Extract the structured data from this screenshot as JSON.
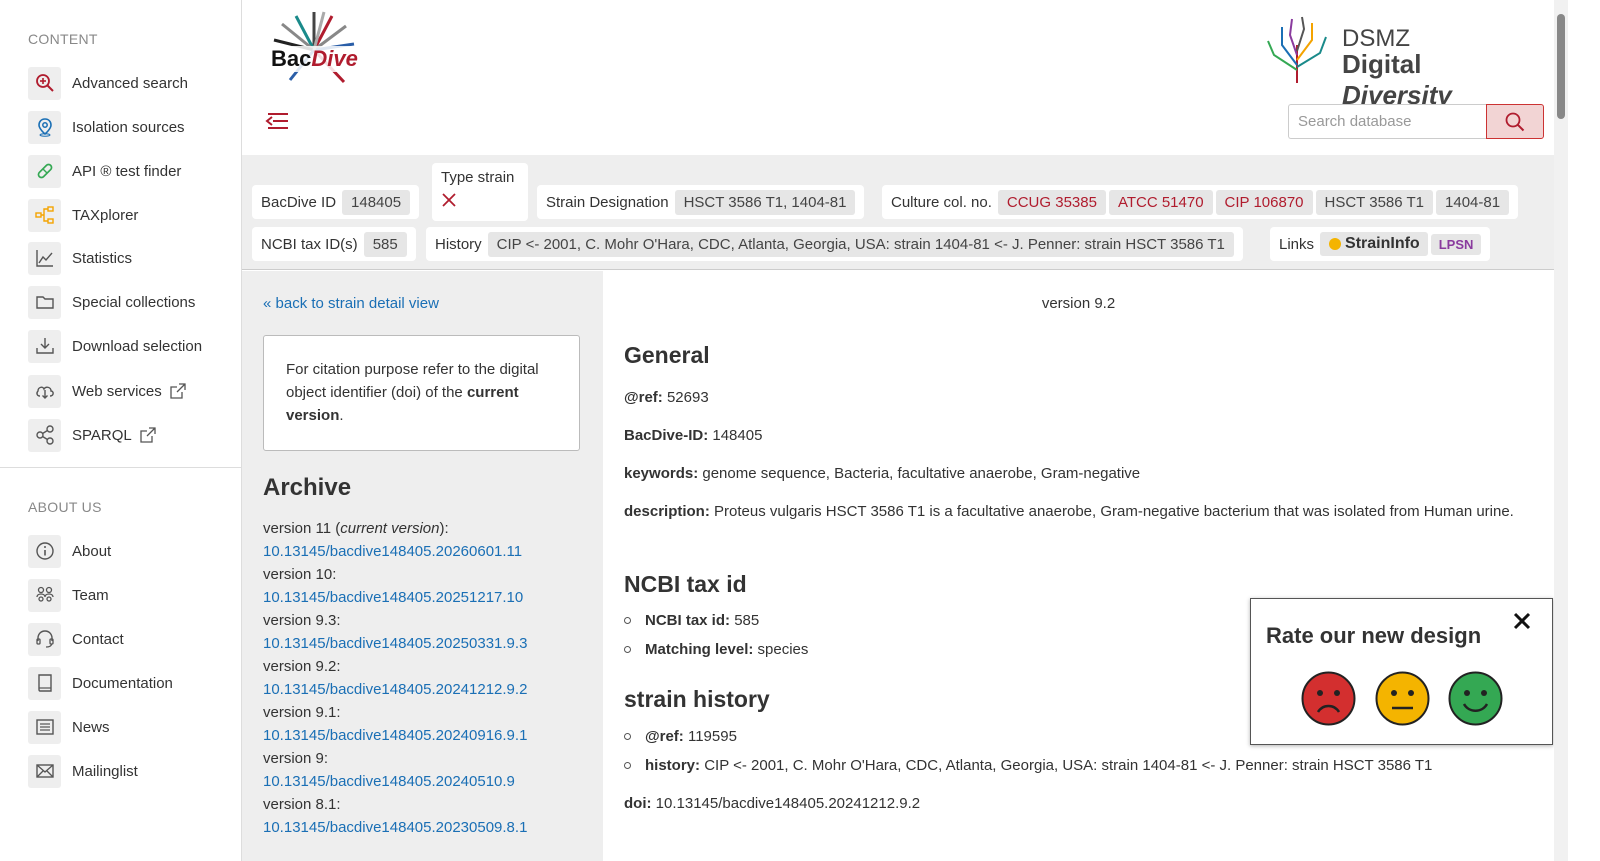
{
  "sidebar": {
    "content_heading": "CONTENT",
    "content_items": [
      {
        "label": "Advanced search",
        "icon": "search-plus-icon"
      },
      {
        "label": "Isolation sources",
        "icon": "location-pin-icon"
      },
      {
        "label": "API ® test finder",
        "icon": "pill-icon"
      },
      {
        "label": "TAXplorer",
        "icon": "tree-icon"
      },
      {
        "label": "Statistics",
        "icon": "line-chart-icon"
      },
      {
        "label": "Special collections",
        "icon": "folder-icon"
      },
      {
        "label": "Download selection",
        "icon": "download-icon"
      },
      {
        "label": "Web services",
        "icon": "cloud-download-icon"
      },
      {
        "label": "SPARQL",
        "icon": "share-nodes-icon"
      }
    ],
    "about_heading": "ABOUT US",
    "about_items": [
      {
        "label": "About",
        "icon": "info-icon"
      },
      {
        "label": "Team",
        "icon": "team-icon"
      },
      {
        "label": "Contact",
        "icon": "headset-icon"
      },
      {
        "label": "Documentation",
        "icon": "book-icon"
      },
      {
        "label": "News",
        "icon": "newspaper-icon"
      },
      {
        "label": "Mailinglist",
        "icon": "envelope-icon"
      }
    ]
  },
  "header": {
    "logo_text": "BacDive",
    "dsmz_line1": "DSMZ",
    "dsmz_line2a": "Digital",
    "dsmz_line2b": "Diversity",
    "search_placeholder": "Search database"
  },
  "infobar": {
    "bacdive_id_label": "BacDive ID",
    "bacdive_id": "148405",
    "type_strain_label": "Type strain",
    "strain_designation_label": "Strain Designation",
    "strain_designation": "HSCT 3586 T1, 1404-81",
    "culture_label": "Culture col. no.",
    "culture_nos": [
      "CCUG 35385",
      "ATCC 51470",
      "CIP 106870",
      "HSCT 3586 T1",
      "1404-81"
    ],
    "ncbi_label": "NCBI tax ID(s)",
    "ncbi_id": "585",
    "history_label": "History",
    "history": "CIP <- 2001, C. Mohr O'Hara, CDC, Atlanta, Georgia, USA: strain 1404-81 <- J. Penner: strain HSCT 3586 T1",
    "links_label": "Links",
    "link_straininfo": "StrainInfo",
    "link_lpsn": "LPSN"
  },
  "left": {
    "back_link": "« back to strain detail view",
    "citation_pre": "For citation purpose refer to the digital object identifier (doi) of the ",
    "citation_bold": "current version",
    "citation_post": ".",
    "archive_title": "Archive",
    "archive": [
      {
        "version": "version 11 (",
        "current": "current version",
        "suffix": "):",
        "doi": "10.13145/bacdive148405.20260601.11"
      },
      {
        "version": "version 10:",
        "current": "",
        "suffix": "",
        "doi": "10.13145/bacdive148405.20251217.10"
      },
      {
        "version": "version 9.3:",
        "current": "",
        "suffix": "",
        "doi": "10.13145/bacdive148405.20250331.9.3"
      },
      {
        "version": "version 9.2:",
        "current": "",
        "suffix": "",
        "doi": "10.13145/bacdive148405.20241212.9.2"
      },
      {
        "version": "version 9.1:",
        "current": "",
        "suffix": "",
        "doi": "10.13145/bacdive148405.20240916.9.1"
      },
      {
        "version": "version 9:",
        "current": "",
        "suffix": "",
        "doi": "10.13145/bacdive148405.20240510.9"
      },
      {
        "version": "version 8.1:",
        "current": "",
        "suffix": "",
        "doi": "10.13145/bacdive148405.20230509.8.1"
      }
    ]
  },
  "main": {
    "version": "version 9.2",
    "general_title": "General",
    "ref_label": "@ref:",
    "ref_value": "52693",
    "bacdive_id_label": "BacDive-ID:",
    "bacdive_id_value": "148405",
    "keywords_label": "keywords:",
    "keywords_value": "genome sequence, Bacteria, facultative anaerobe, Gram-negative",
    "description_label": "description:",
    "description_value": "Proteus vulgaris HSCT 3586 T1 is a facultative anaerobe, Gram-negative bacterium that was isolated from Human urine.",
    "ncbi_title": "NCBI tax id",
    "ncbi_taxid_label": "NCBI tax id:",
    "ncbi_taxid_value": "585",
    "matching_label": "Matching level:",
    "matching_value": "species",
    "history_title": "strain history",
    "hist_ref_label": "@ref:",
    "hist_ref_value": "119595",
    "hist_label": "history:",
    "hist_value": "CIP <- 2001, C. Mohr O'Hara, CDC, Atlanta, Georgia, USA: strain 1404-81 <- J. Penner: strain HSCT 3586 T1",
    "doi_label": "doi:",
    "doi_value": "10.13145/bacdive148405.20241212.9.2"
  },
  "rating": {
    "title": "Rate our new design"
  },
  "colors": {
    "accent_red": "#b01c2e",
    "link_blue": "#1a6fb5",
    "sad": "#d32f2f",
    "neutral": "#f4b400",
    "happy": "#34a853"
  }
}
